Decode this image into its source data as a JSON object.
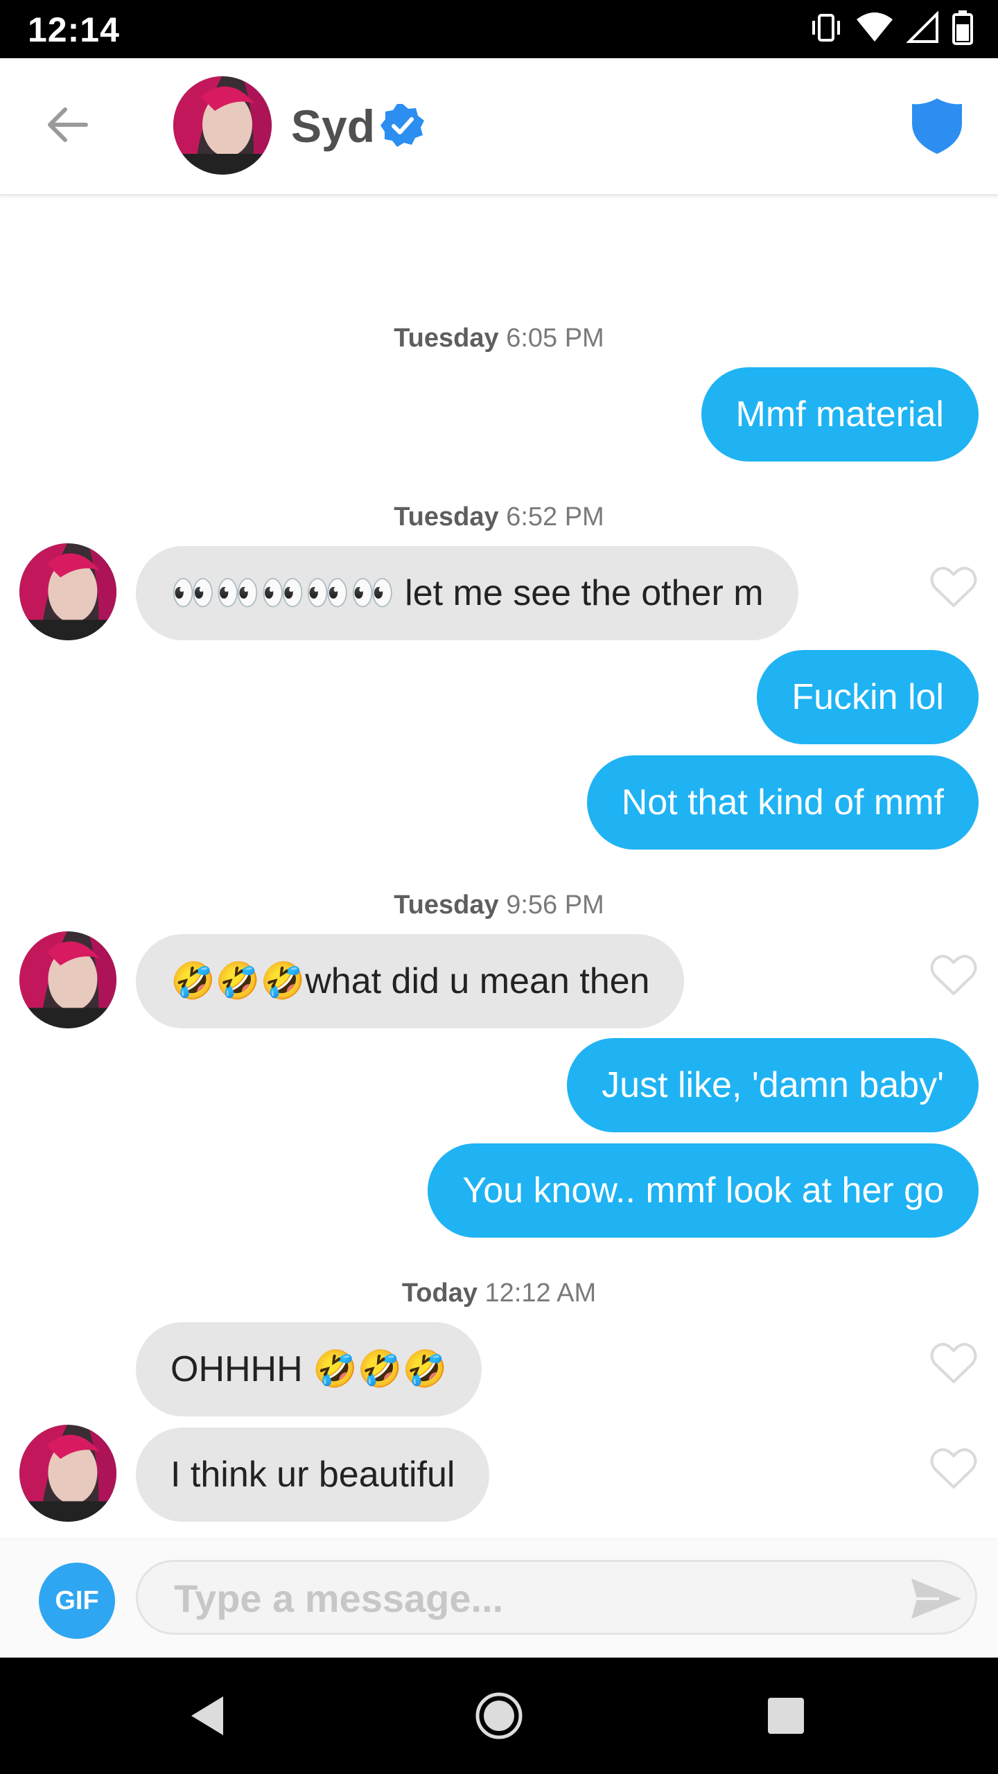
{
  "status_bar": {
    "time": "12:14"
  },
  "header": {
    "contact_name": "Syd",
    "accent": "#2b8ef0"
  },
  "messages": [
    {
      "type": "timestamp",
      "day": "Tuesday",
      "time": "6:05 PM"
    },
    {
      "type": "outgoing",
      "text": "Mmf material"
    },
    {
      "type": "timestamp",
      "day": "Tuesday",
      "time": "6:52 PM"
    },
    {
      "type": "incoming",
      "text": "👀👀👀👀👀 let me see the other m"
    },
    {
      "type": "outgoing",
      "text": "Fuckin lol"
    },
    {
      "type": "outgoing",
      "text": "Not that kind of mmf"
    },
    {
      "type": "timestamp",
      "day": "Tuesday",
      "time": "9:56 PM"
    },
    {
      "type": "incoming",
      "text": "🤣🤣🤣what did u mean then"
    },
    {
      "type": "outgoing",
      "text": "Just like, 'damn baby'"
    },
    {
      "type": "outgoing",
      "text": "You know.. mmf look at her go"
    },
    {
      "type": "timestamp",
      "day": "Today",
      "time": "12:12 AM"
    },
    {
      "type": "incoming",
      "text": "OHHHH 🤣🤣🤣"
    },
    {
      "type": "incoming",
      "text": "I think ur beautiful"
    }
  ],
  "composer": {
    "gif_label": "GIF",
    "placeholder": "Type a message..."
  },
  "colors": {
    "outgoing_bubble": "#1fb3f3",
    "incoming_bubble": "#e6e6e6",
    "gif_button": "#2fa6f1"
  },
  "icons": [
    "arrow-left-icon",
    "verified-badge-icon",
    "shield-icon",
    "heart-icon",
    "send-icon",
    "nav-back-icon",
    "nav-home-icon",
    "nav-recents-icon"
  ]
}
